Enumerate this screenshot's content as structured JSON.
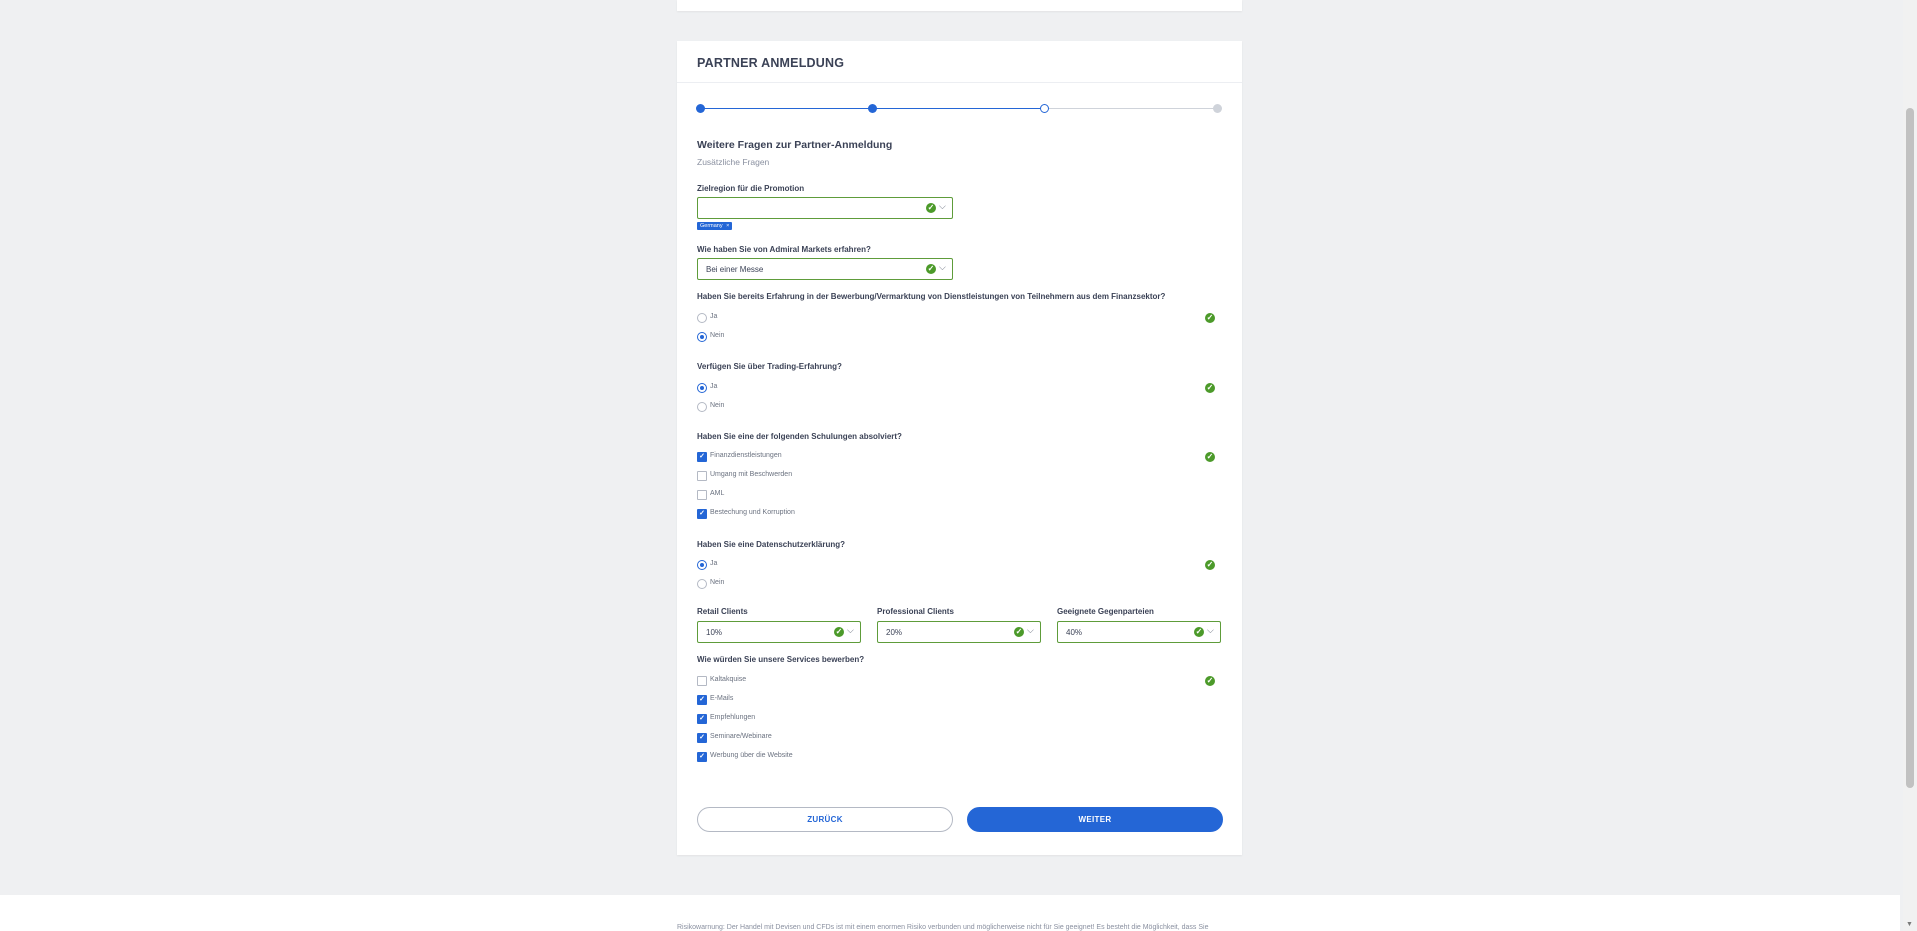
{
  "form": {
    "title": "PARTNER ANMELDUNG",
    "stepper": {
      "total_steps": 4,
      "completed_steps": 2,
      "current_step": 3
    },
    "section_title": "Weitere Fragen zur Partner-Anmeldung",
    "section_subtitle": "Zusätzliche Fragen",
    "target_region": {
      "label": "Zielregion für die Promotion",
      "value": "",
      "chips": [
        "Germany"
      ]
    },
    "heard_about": {
      "label": "Wie haben Sie von Admiral Markets erfahren?",
      "value": "Bei einer Messe"
    },
    "q_experience": {
      "label": "Haben Sie bereits Erfahrung in der Bewerbung/Vermarktung von Dienstleistungen von Teilnehmern aus dem Finanzsektor?",
      "options": [
        "Ja",
        "Nein"
      ],
      "selected": "Nein"
    },
    "q_trading": {
      "label": "Verfügen Sie über Trading-Erfahrung?",
      "options": [
        "Ja",
        "Nein"
      ],
      "selected": "Ja"
    },
    "q_trainings": {
      "label": "Haben Sie eine der folgenden Schulungen absolviert?",
      "options": [
        {
          "label": "Finanzdienstleistungen",
          "checked": true
        },
        {
          "label": "Umgang mit Beschwerden",
          "checked": false
        },
        {
          "label": "AML",
          "checked": false
        },
        {
          "label": "Bestechung und Korruption",
          "checked": true
        }
      ]
    },
    "q_privacy": {
      "label": "Haben Sie eine Datenschutzerklärung?",
      "options": [
        "Ja",
        "Nein"
      ],
      "selected": "Ja"
    },
    "clients": {
      "retail": {
        "label": "Retail Clients",
        "value": "10%"
      },
      "professional": {
        "label": "Professional Clients",
        "value": "20%"
      },
      "counterparties": {
        "label": "Geeignete Gegenparteien",
        "value": "40%"
      }
    },
    "q_promotion": {
      "label": "Wie würden Sie unsere Services bewerben?",
      "options": [
        {
          "label": "Kaltakquise",
          "checked": false
        },
        {
          "label": "E-Mails",
          "checked": true
        },
        {
          "label": "Empfehlungen",
          "checked": true
        },
        {
          "label": "Seminare/Webinare",
          "checked": true
        },
        {
          "label": "Werbung über die Website",
          "checked": true
        }
      ]
    },
    "buttons": {
      "back": "ZURÜCK",
      "next": "WEITER"
    }
  },
  "footer": {
    "risk_warning": "Risikowarnung: Der Handel mit Devisen und CFDs ist mit einem enormen Risiko verbunden und möglicherweise nicht für Sie geeignet! Es besteht die Möglichkeit, dass Sie"
  },
  "colors": {
    "accent": "#2466d6",
    "success": "#4c9a2a",
    "field_border_valid": "#5e9c3a",
    "page_background": "#eff0f2"
  },
  "icons": {
    "valid": "check-circle-icon",
    "dropdown": "chevron-down-icon",
    "chip_remove": "close-icon"
  }
}
